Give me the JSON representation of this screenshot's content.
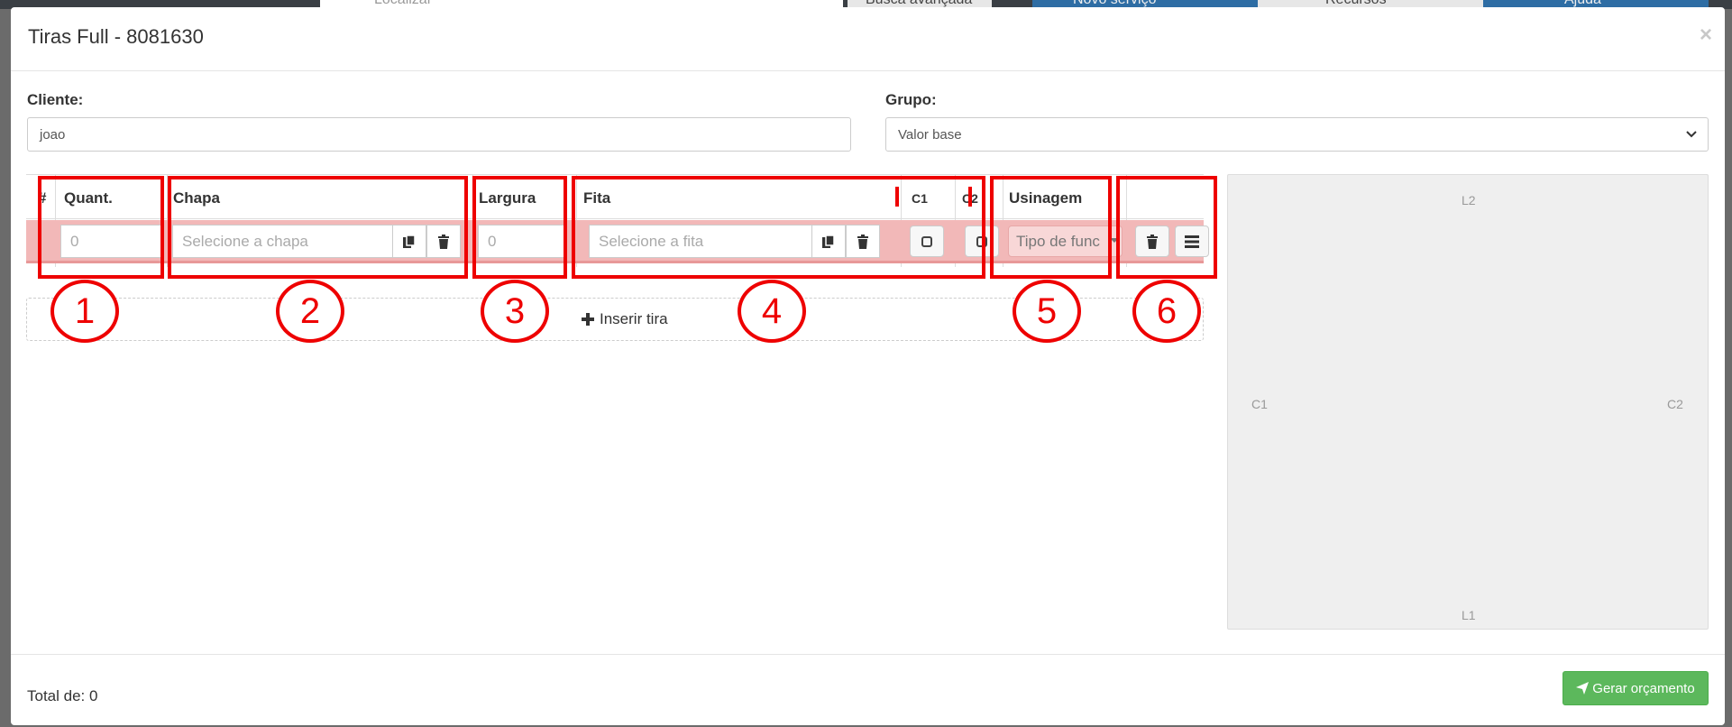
{
  "modal": {
    "title": "Tiras Full - 8081630",
    "close_glyph": "×"
  },
  "form": {
    "cliente_label": "Cliente:",
    "cliente_value": "joao",
    "grupo_label": "Grupo:",
    "grupo_value": "Valor base"
  },
  "table": {
    "headers": {
      "hash": "#",
      "quant": "Quant.",
      "chapa": "Chapa",
      "largura": "Largura",
      "fita": "Fita",
      "c1": "C1",
      "c2": "C2",
      "usinagem": "Usinagem"
    },
    "row": {
      "quant_placeholder": "0",
      "chapa_placeholder": "Selecione a chapa",
      "largura_placeholder": "0",
      "fita_placeholder": "Selecione a fita",
      "usinagem_placeholder": "Tipo de func"
    },
    "insert_label": "Inserir tira"
  },
  "preview": {
    "top": "L2",
    "bottom": "L1",
    "left": "C1",
    "right": "C2"
  },
  "annotations": [
    "1",
    "2",
    "3",
    "4",
    "5",
    "6"
  ],
  "footer": {
    "total": "Total de: 0",
    "generate_button": "Gerar orçamento"
  },
  "background": {
    "search_placeholder": "Localizar",
    "advanced_search": "Busca avançada",
    "new_service": "Novo serviço",
    "resources": "Recursos",
    "help": "Ajuda"
  },
  "colors": {
    "annotation_red": "#ee0000",
    "row_highlight": "#f2b8b8",
    "primary_green": "#5cb85c"
  }
}
